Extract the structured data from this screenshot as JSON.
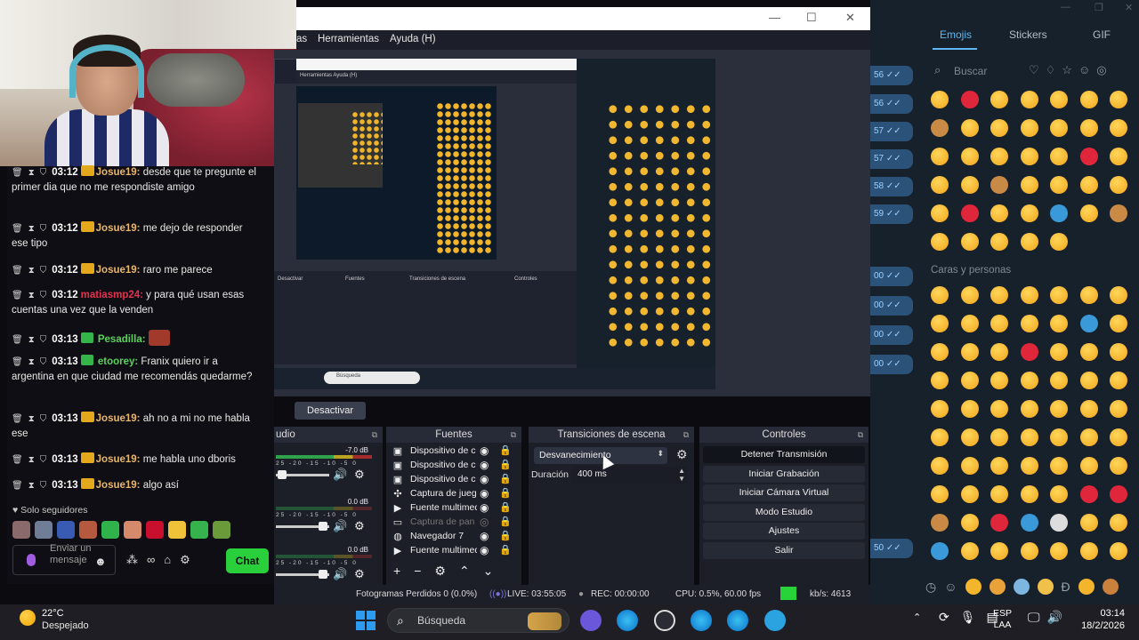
{
  "obs": {
    "menu": {
      "partial": "as",
      "tools": "Herramientas",
      "help": "Ayuda (H)"
    },
    "nested_preview": {
      "menu": "Herramientas   Ayuda (H)",
      "search": "Búsqueda"
    },
    "preview_button": "Desactivar",
    "docks": {
      "audio": "udio",
      "sources": "Fuentes",
      "transitions": "Transiciones de escena",
      "controls": "Controles"
    },
    "audio_mixer": [
      {
        "db": "-7.0 dB",
        "scale": "25 -20 -15 -10 -5 0"
      },
      {
        "db": "0.0 dB",
        "scale": "25 -20 -15 -10 -5 0"
      },
      {
        "db": "0.0 dB",
        "scale": "25 -20 -15 -10 -5 0"
      }
    ],
    "sources": [
      {
        "name": "Dispositivo de c",
        "icon": "camera-icon"
      },
      {
        "name": "Dispositivo de c",
        "icon": "camera-icon"
      },
      {
        "name": "Dispositivo de c",
        "icon": "camera-icon"
      },
      {
        "name": "Captura de jueg",
        "icon": "gamepad-icon"
      },
      {
        "name": "Fuente multimed",
        "icon": "play-icon"
      },
      {
        "name": "Captura de pan",
        "icon": "monitor-icon"
      },
      {
        "name": "Navegador 7",
        "icon": "globe-icon"
      },
      {
        "name": "Fuente multimed",
        "icon": "play-icon"
      }
    ],
    "transition": {
      "selected": "Desvanecimiento",
      "duration_label": "Duración",
      "duration": "400 ms"
    },
    "controls": [
      "Detener Transmisión",
      "Iniciar Grabación",
      "Iniciar Cámara Virtual",
      "Modo Estudio",
      "Ajustes",
      "Salir"
    ],
    "status": {
      "dropped": "Fotogramas Perdidos 0 (0.0%)",
      "live": "LIVE: 03:55:05",
      "rec": "REC: 00:00:00",
      "cpu": "CPU: 0.5%, 60.00 fps",
      "kbps": "kb/s: 4613"
    },
    "status_color": "#28d33a"
  },
  "chat": {
    "messages": [
      {
        "time": "03:12",
        "user": "Josue19:",
        "text": " desde que te pregunte el primer dia que no me respondiste amigo",
        "color": "#e9b76b"
      },
      {
        "time": "03:12",
        "user": "Josue19:",
        "text": " me dejo de responder ese tipo",
        "color": "#e9b76b"
      },
      {
        "time": "03:12",
        "user": "Josue19:",
        "text": " raro me parece",
        "color": "#e9b76b"
      },
      {
        "time": "03:12",
        "user": "matiasmp24:",
        "text": " y para qué usan esas cuentas una vez que la venden",
        "color": "#e6324f"
      },
      {
        "time": "03:13",
        "user": "Pesadilla:",
        "text": "",
        "color": "#59d25a"
      },
      {
        "time": "03:13",
        "user": "etoorey:",
        "text": " Franix quiero ir a argentina en que ciudad me recomendás quedarme?",
        "color": "#59d25a"
      },
      {
        "time": "03:13",
        "user": "Josue19:",
        "text": " ah no a mi no me habla ese",
        "color": "#e9b76b"
      },
      {
        "time": "03:13",
        "user": "Josue19:",
        "text": " me habla uno dboris",
        "color": "#e9b76b"
      },
      {
        "time": "03:13",
        "user": "Josue19:",
        "text": " algo así",
        "color": "#e9b76b"
      }
    ],
    "followers_only": "♥ Solo seguidores",
    "input_placeholder": "Enviar un mensaje",
    "chat_button": "Chat"
  },
  "telegram": {
    "tabs": [
      "Emojis",
      "Stickers",
      "GIF"
    ],
    "active_tab": "Emojis",
    "search_placeholder": "Buscar",
    "section": "Caras y personas",
    "chat_times": [
      "56",
      "56",
      "57",
      "57",
      "58",
      "59",
      "00",
      "00",
      "00",
      "00",
      "50"
    ]
  },
  "taskbar": {
    "weather_temp": "22°C",
    "weather_desc": "Despejado",
    "search_placeholder": "Búsqueda",
    "lang_top": "ESP",
    "lang_bottom": "LAA",
    "time": "03:14",
    "date": "18/2/2026"
  }
}
